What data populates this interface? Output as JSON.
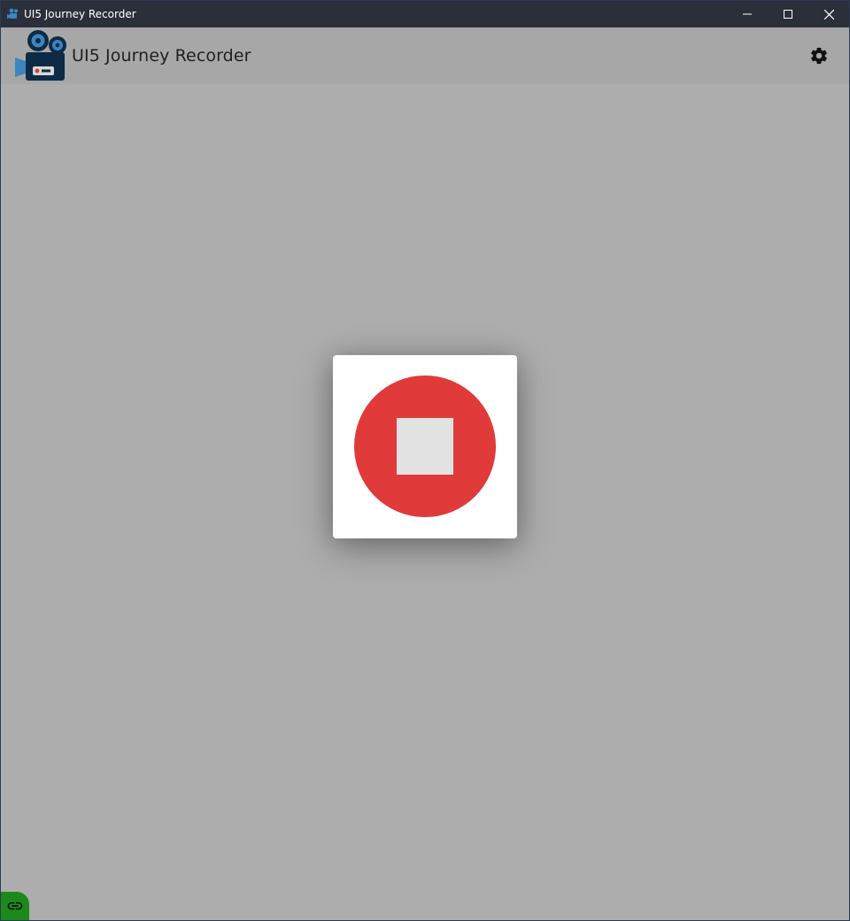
{
  "window": {
    "title": "UI5 Journey Recorder",
    "icons": {
      "app": "camera-icon",
      "minimize": "minimize-icon",
      "maximize": "maximize-icon",
      "close": "close-icon"
    }
  },
  "header": {
    "title": "UI5 Journey Recorder",
    "logo_icon": "movie-camera-icon",
    "settings_icon": "gear-icon"
  },
  "dialog": {
    "stop_icon": "stop-icon"
  },
  "status": {
    "connection_icon": "link-icon",
    "state": "connected"
  },
  "colors": {
    "titlebar": "#2b2f3a",
    "overlay": "#adadad",
    "record_red": "#e03a3a",
    "stop_square": "#e2e2e2",
    "connected_green": "#1b8a1b"
  }
}
